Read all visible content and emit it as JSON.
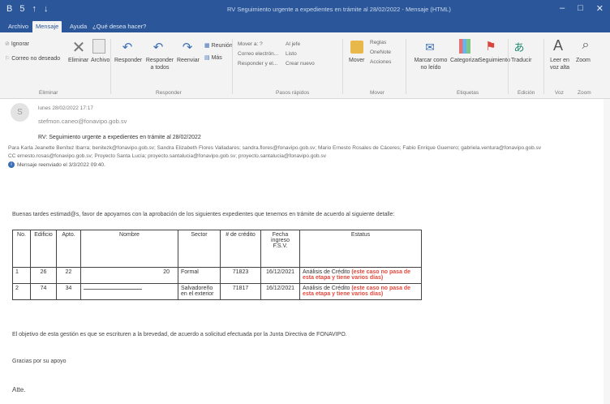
{
  "titlebar": {
    "qat_save": "B",
    "qat_undo": "5",
    "qat_up": "↑",
    "qat_down": "↓",
    "window_title": "RV Seguimiento urgente a expedientes en trámite al 28/02/2022 - Mensaje (HTML)",
    "min": "–",
    "max": "□",
    "close": "✕"
  },
  "tabs": [
    {
      "label": "Archivo"
    },
    {
      "label": "Mensaje"
    },
    {
      "label": "Ayuda"
    },
    {
      "label": "¿Qué desea hacer?"
    }
  ],
  "ribbon": {
    "eliminar": {
      "ignorar": "Ignorar",
      "correo_no_deseado": "Correo no deseado",
      "eliminar": "Eliminar",
      "archivo": "Archivo",
      "label": "Eliminar"
    },
    "responder": {
      "responder": "Responder",
      "responder_todos": "Responder a todos",
      "reenviar": "Reenviar",
      "reunion": "Reunión",
      "mas": "Más",
      "label": "Responder"
    },
    "pasos": {
      "mover_a": "Mover a: ?",
      "correo_electronico": "Correo electrón...",
      "responder_y_elim": "Responder y el...",
      "al_jefe": "Al jefe",
      "listo": "Listo",
      "crear_nuevo": "Crear nuevo",
      "label": "Pasos rápidos"
    },
    "mover": {
      "mover": "Mover",
      "reglas": "Reglas",
      "onenote": "OneNote",
      "acciones": "Acciones",
      "label": "Mover"
    },
    "etiquetas": {
      "marcar_no_leido": "Marcar como no leído",
      "categorizar": "Categorizar",
      "seguimiento": "Seguimiento",
      "label": "Etiquetas"
    },
    "edicion": {
      "traducir": "Traducir",
      "label": "Edición"
    },
    "voz": {
      "leer_en_voz_alta": "Leer en voz alta",
      "label": "Voz"
    },
    "zoom": {
      "zoom": "Zoom",
      "label": "Zoom"
    }
  },
  "message": {
    "avatar_letter": "S",
    "date": "lunes 28/02/2022 17:17",
    "sender": "stefmon.caneo@fonavipo.gob.sv",
    "subject": "RV: Seguimiento urgente a expedientes en trámite al 28/02/2022",
    "para_label": "Para",
    "para": "Karla Jeanette Benítez Ibarra; benitezk@fonavipo.gob.sv; Sandra Elizabeth Flores Valladares; sandra.flores@fonavipo.gob.sv; Mario Ernesto Rosales de Cáceres; Fabio Enrique Guerrero; gabriela.ventura@fonavipo.gob.sv",
    "cc_label": "CC",
    "cc": "ernesto.rosas@fonavipo.gob.sv; Proyecto Santa Lucía; proyecto.santalucia@fonavipo.gob.sv; proyecto.santalucia@fonavipo.gob.sv",
    "forwarded": "Mensaje reenviado el 3/3/2022 09:40."
  },
  "body": {
    "greeting": "Buenas tardes estimad@s, favor de apoyarnos con la aprobación de los siguientes expedientes que tenemos en trámite de acuerdo al siguiente detalle:",
    "table": {
      "headers": [
        "No.",
        "Edificio",
        "Apto.",
        "Nombre",
        "Sector",
        "# de crédito",
        "Fecha ingreso F.S.V.",
        "Estatus"
      ],
      "rows": [
        {
          "no": "1",
          "edificio": "26",
          "apto": "22",
          "nombre": "20",
          "sector": "Formal",
          "credito": "71823",
          "fecha": "16/12/2021",
          "estatus": "Análisis de Crédito",
          "nota": "(este caso no pasa de esta etapa y tiene varios días)"
        },
        {
          "no": "2",
          "edificio": "74",
          "apto": "34",
          "nombre": "",
          "sector": "Salvadoreño en el exterior",
          "credito": "71817",
          "fecha": "16/12/2021",
          "estatus": "Análisis de Crédito",
          "nota": "(este caso no pasa de esta etapa y tiene varios días)"
        }
      ]
    },
    "objetivo": "El objetivo de esta gestión es que se escrituren a la brevedad, de acuerdo a solicitud efectuada por la Junta Directiva de FONAVIPO.",
    "gracias": "Gracias por su apoyo",
    "atte": "Atte."
  }
}
